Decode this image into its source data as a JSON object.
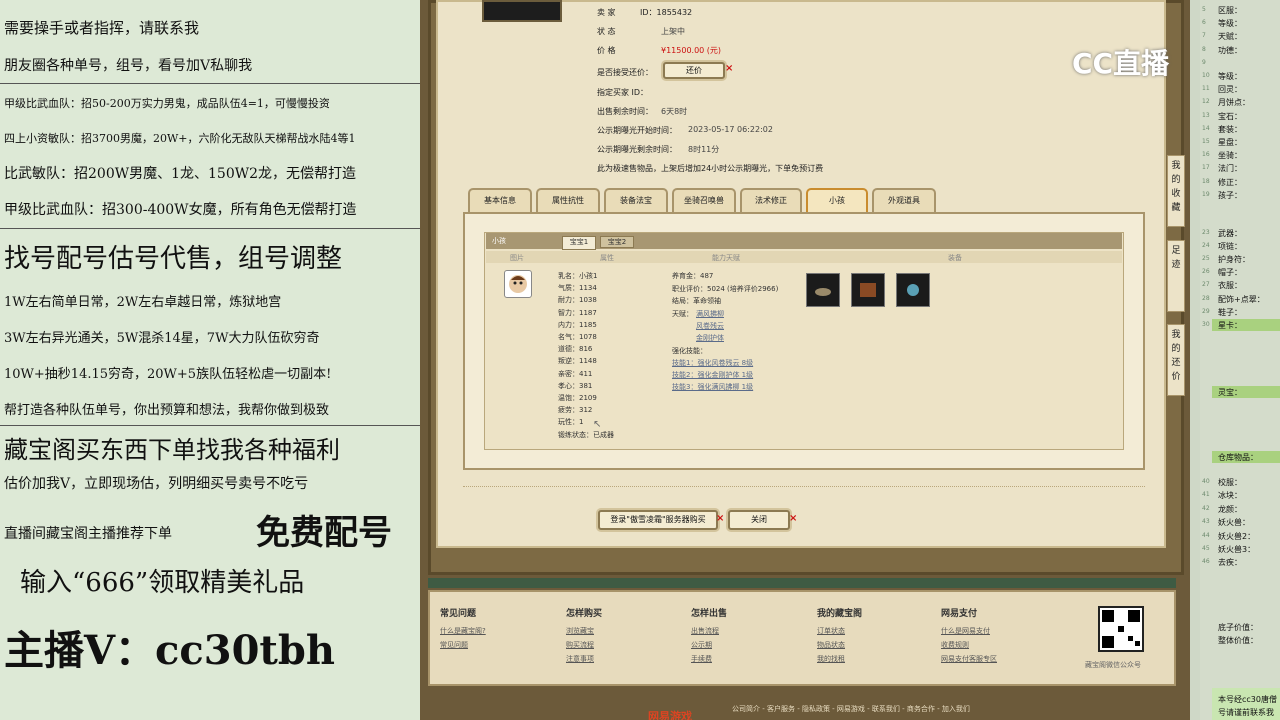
{
  "left_ads": [
    {
      "text": "需要操手或者指挥，请联系我",
      "size": 15
    },
    {
      "text": "朋友圈各种单号，组号，看号加Ⅴ私聊我",
      "size": 14
    },
    {
      "text": "甲级比武血队：招50-200万实力男鬼，成品队伍4=1，可慢慢投资",
      "size": 11
    },
    {
      "text": "四上小资敏队：招3700男魔，20W+，六阶化无敌队天梯帮战水陆4等1",
      "size": 11
    },
    {
      "text": "比武敏队：招200W男魔、1龙、150W2龙，无偿帮打造",
      "size": 14
    },
    {
      "text": "甲级比武血队：招300-400W女魔，所有角色无偿帮打造",
      "size": 14
    },
    {
      "text": "找号配号估号代售，组号调整",
      "size": 26
    },
    {
      "text": "1W左右简单日常，2W左右卓越日常，炼狱地宫",
      "size": 13
    },
    {
      "text": "3W左右异光通关，5W混杀14星，7W大力队伍砍穷奇",
      "size": 13
    },
    {
      "text": "10W+抽秒14.15穷奇，20W+5族队伍轻松虐一切副本!",
      "size": 13
    },
    {
      "text": "帮打造各种队伍单号，你出预算和想法，我帮你做到极致",
      "size": 13
    },
    {
      "text": "藏宝阁买东西下单找我各种福利",
      "size": 24
    },
    {
      "text": "估价加我V，立即现场估，列明细买号卖号不吃亏",
      "size": 14
    },
    {
      "text": "直播间藏宝阁主播推荐下单",
      "size": 14
    },
    {
      "text": "免费配号",
      "size": 34
    },
    {
      "text": "输入“666”领取精美礼品",
      "size": 26
    },
    {
      "text": "主播V：cc30tbh",
      "size": 40
    }
  ],
  "listing": {
    "seller_label": "卖 家",
    "seller_id": "ID：1855432",
    "status_label": "状      态",
    "status": "上架中",
    "price_label": "价      格",
    "price": "¥11500.00 (元)",
    "bargain_label": "是否接受还价：",
    "bargain_button": "还价",
    "buyer_label": "指定买家 ID：",
    "remain_label": "出售剩余时间：",
    "remain": "6天8时",
    "pub_start_label": "公示期曝光开始时间：",
    "pub_start": "2023-05-17 06:22:02",
    "pub_remain_label": "公示期曝光剩余时间：",
    "pub_remain": "8时11分",
    "notice": "此为极速售物品，上架后增加24小时公示期曝光，下单免预订费"
  },
  "tabs": [
    "基本信息",
    "属性抗性",
    "装备法宝",
    "坐骑召唤兽",
    "法术修正",
    "小孩",
    "外观道具"
  ],
  "child_panel": {
    "title": "小孩",
    "subtabs": [
      "宝宝1",
      "宝宝2"
    ],
    "col_headers": [
      "图片",
      "属性",
      "能力天赋",
      "装备"
    ],
    "attrs": [
      "乳名：小孩1",
      "气质：1134",
      "耐力：1038",
      "智力：1187",
      "内力：1185",
      "名气：1078",
      "道德：816",
      "叛逆：1148",
      "亲密：411",
      "孝心：381",
      "温饱：2109",
      "疲劳：312",
      "玩性：1",
      "锻练状态：已成器"
    ],
    "ability": [
      "养育金：487",
      "职业评价：5024 (培养评价2966)",
      "结局：革命领袖",
      "天赋："
    ],
    "talents": [
      "满风拂柳",
      "风卷残云",
      "金刚护体"
    ],
    "skills_title": "强化技能：",
    "skills": [
      "技能1：强化风卷残云 8级",
      "技能2：强化金刚护体 1级",
      "技能3：强化满风拂柳 1级"
    ]
  },
  "action_buttons": {
    "login": "登录\"傲雪凌霜\"服务器购买",
    "close": "关闭"
  },
  "side_tabs": [
    "我的收藏",
    "足迹",
    "我的还价"
  ],
  "footer": {
    "cols": [
      {
        "head": "常见问题",
        "links": [
          "什么是藏宝阁?",
          "常见问题"
        ]
      },
      {
        "head": "怎样购买",
        "links": [
          "浏览藏宝",
          "购买流程",
          "注意事项"
        ]
      },
      {
        "head": "怎样出售",
        "links": [
          "出售流程",
          "公示期",
          "手续费"
        ]
      },
      {
        "head": "我的藏宝阁",
        "links": [
          "订单状态",
          "物品状态",
          "我的找租"
        ]
      },
      {
        "head": "网易支付",
        "links": [
          "什么是网易支付",
          "收费规则",
          "网易支付客服专区"
        ]
      }
    ],
    "qr_caption": "藏宝阁微信公众号",
    "bottom_links": "公司简介 - 客户服务 - 隐私政策 - 网易游戏 - 联系我们 - 商务合作 - 加入我们",
    "brand": "网易游戏"
  },
  "logo_text": "CC直播",
  "right_panel": {
    "rows": [
      {
        "n": "5",
        "t": "区服："
      },
      {
        "n": "6",
        "t": "等级："
      },
      {
        "n": "7",
        "t": "天赋："
      },
      {
        "n": "8",
        "t": "功德："
      },
      {
        "n": "9",
        "t": ""
      },
      {
        "n": "10",
        "t": "等级："
      },
      {
        "n": "11",
        "t": "回灵："
      },
      {
        "n": "12",
        "t": "月饼点："
      },
      {
        "n": "13",
        "t": "宝石："
      },
      {
        "n": "14",
        "t": "套装："
      },
      {
        "n": "15",
        "t": "星盘："
      },
      {
        "n": "16",
        "t": "坐骑："
      },
      {
        "n": "17",
        "t": "法门："
      },
      {
        "n": "18",
        "t": "修正："
      },
      {
        "n": "19",
        "t": "孩子："
      }
    ],
    "rows2": [
      {
        "n": "23",
        "t": "武器："
      },
      {
        "n": "24",
        "t": "项链："
      },
      {
        "n": "25",
        "t": "护身符："
      },
      {
        "n": "26",
        "t": "帽子："
      },
      {
        "n": "27",
        "t": "衣服："
      },
      {
        "n": "28",
        "t": "配饰+点翠："
      },
      {
        "n": "29",
        "t": "鞋子："
      },
      {
        "n": "30",
        "t": "星卡："
      }
    ],
    "lingbao": "灵宝：",
    "cangku": "仓库物品：",
    "rows3": [
      {
        "n": "40",
        "t": "校服："
      },
      {
        "n": "41",
        "t": "冰块："
      },
      {
        "n": "42",
        "t": "龙颜："
      },
      {
        "n": "43",
        "t": "妖火兽："
      },
      {
        "n": "44",
        "t": "妖火兽2："
      },
      {
        "n": "45",
        "t": "妖火兽3："
      },
      {
        "n": "46",
        "t": "去疾："
      }
    ],
    "value_rows": [
      "底子价值：",
      "整体价值："
    ],
    "bottom_note": [
      "本号经cc30唐僧",
      "号请谨前联系我"
    ]
  }
}
